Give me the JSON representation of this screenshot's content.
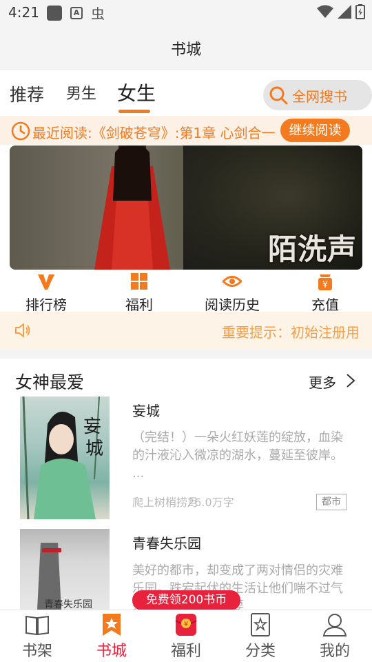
{
  "status": {
    "time": "4:21"
  },
  "header": {
    "title": "书城"
  },
  "tabs": [
    {
      "label": "推荐"
    },
    {
      "label": "男生"
    },
    {
      "label": "女生"
    }
  ],
  "search": {
    "label": "全网搜书"
  },
  "recent": {
    "text": "最近阅读:《剑破苍穹》:第1章 心剑合一",
    "button": "继续阅读"
  },
  "banner": {
    "title_text": "陌洗声"
  },
  "quick_menu": [
    {
      "label": "排行榜",
      "icon": "v-rank-icon"
    },
    {
      "label": "福利",
      "icon": "grid-icon"
    },
    {
      "label": "阅读历史",
      "icon": "eye-icon"
    },
    {
      "label": "充值",
      "icon": "yen-bag-icon"
    }
  ],
  "notice": {
    "text": "重要提示：初始注册用"
  },
  "section": {
    "title": "女神最爱",
    "more": "更多"
  },
  "books": [
    {
      "title": "妄城",
      "desc": "（完结！）一朵火红妖莲的绽放，血染的汁液沁入微凉的湖水，蔓延至彼岸。 ...",
      "author": "爬上树梢捞月",
      "count": "26.0万字",
      "tag": "都市"
    },
    {
      "title": "青春失乐园",
      "desc": "美好的都市，却变成了两对情侣的灾难乐园。跌宕起伏的生活让他们喘不过气来，感情就像在被耍",
      "cover_text": "青春失乐园"
    }
  ],
  "promo": {
    "label": "免费领200书币"
  },
  "bottom_nav": [
    {
      "label": "书架",
      "icon": "book-icon"
    },
    {
      "label": "书城",
      "icon": "bookmark-star-icon",
      "active": true
    },
    {
      "label": "福利",
      "icon": "red-packet-icon"
    },
    {
      "label": "分类",
      "icon": "category-icon"
    },
    {
      "label": "我的",
      "icon": "user-icon"
    }
  ],
  "colors": {
    "accent": "#f47a1f",
    "red": "#e8213d",
    "notice": "#f4a04a"
  }
}
